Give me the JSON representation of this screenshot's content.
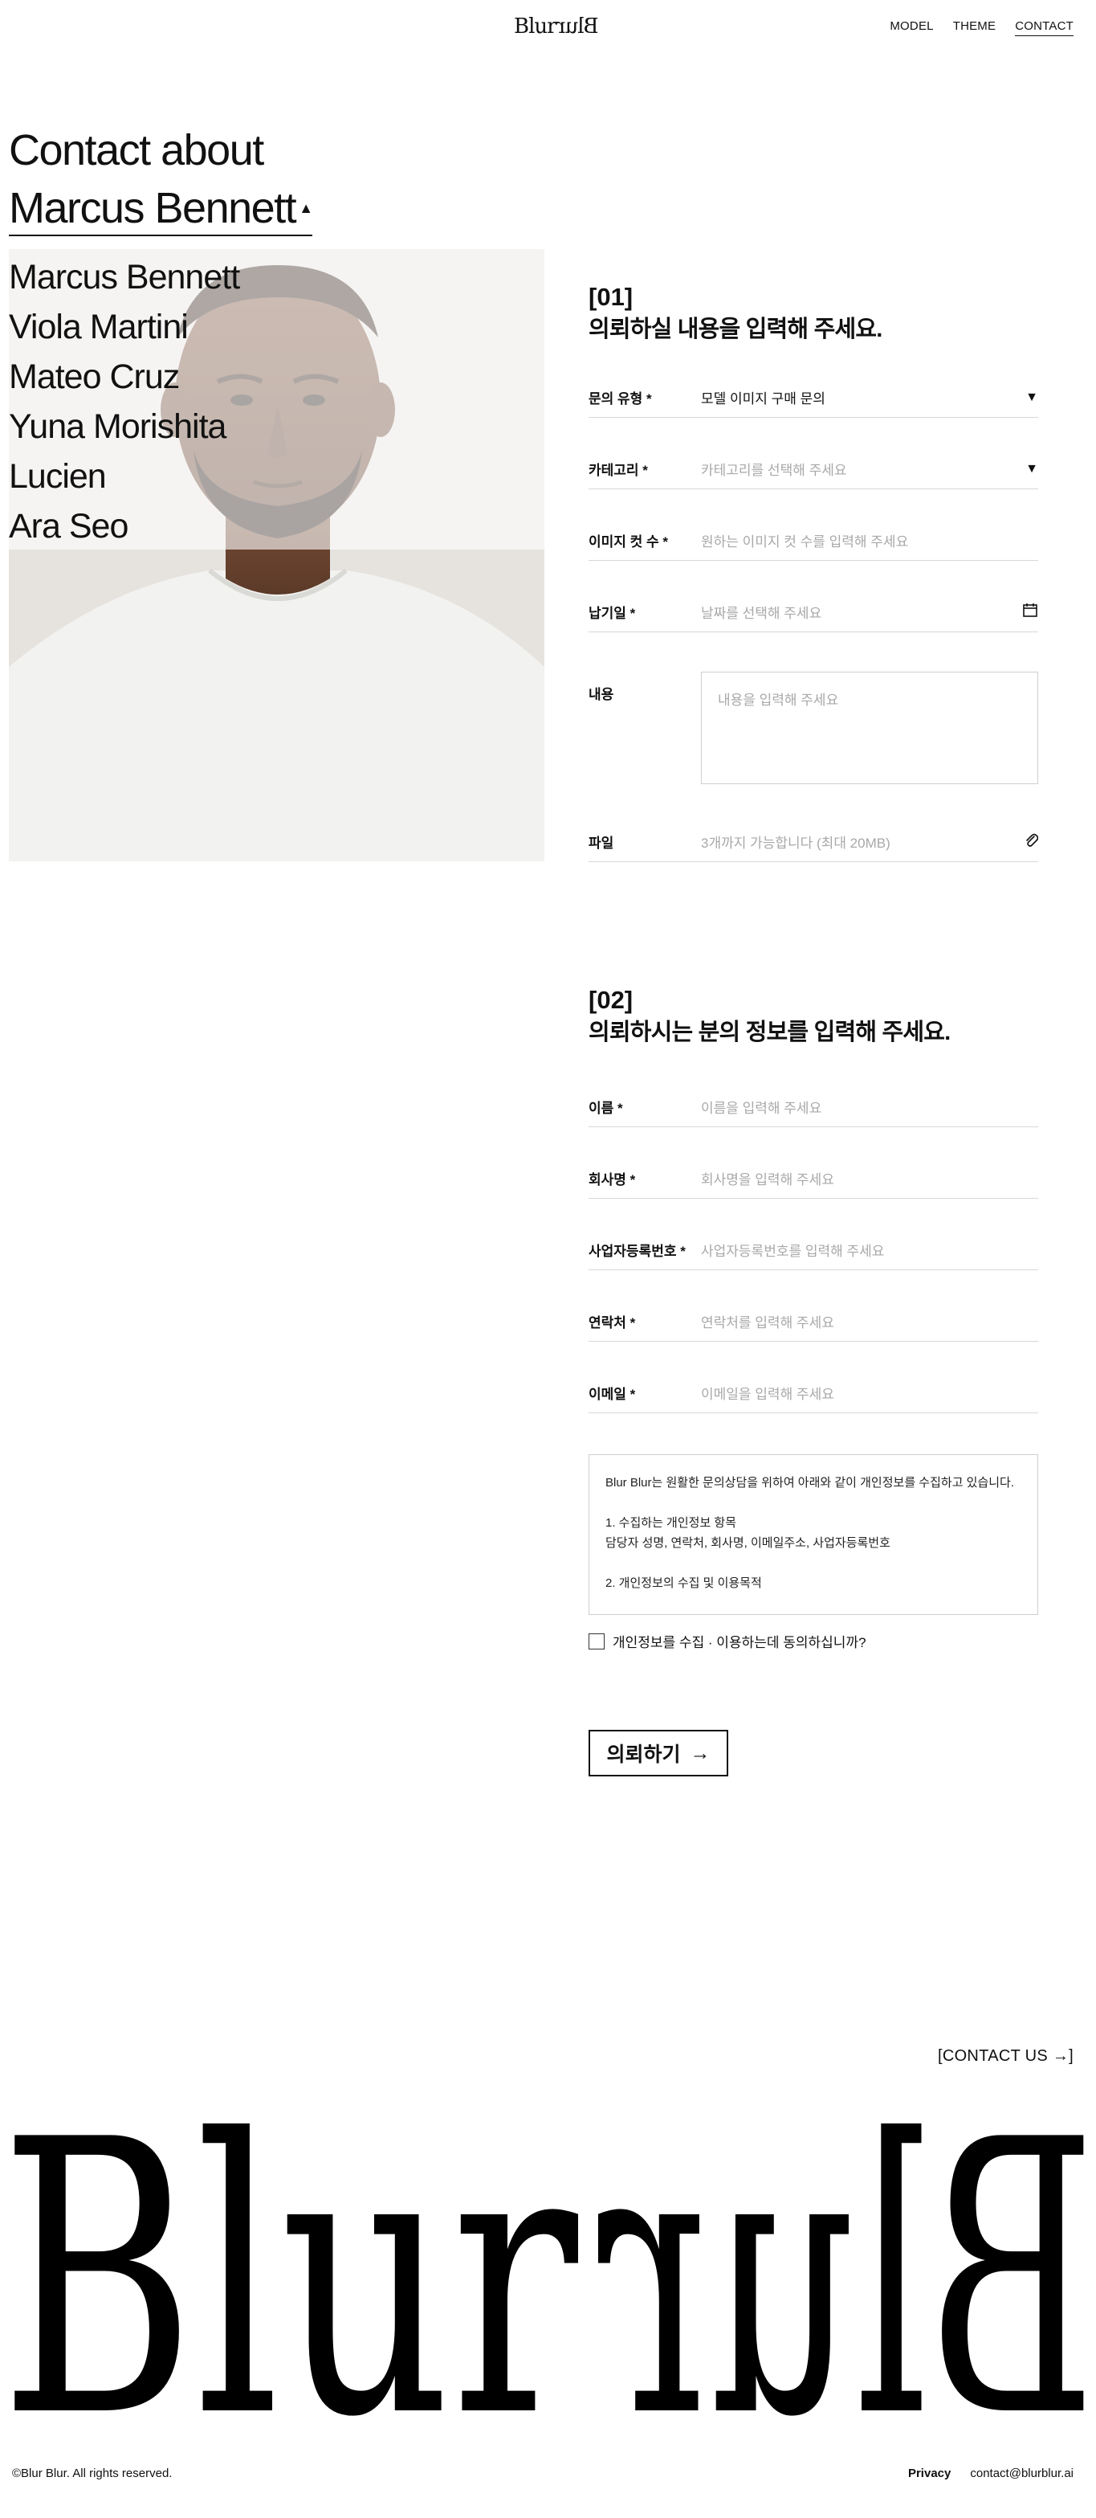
{
  "header": {
    "logo_left": "Blur",
    "logo_right": "Blur",
    "nav": [
      "MODEL",
      "THEME",
      "CONTACT"
    ]
  },
  "contact": {
    "heading": "Contact about",
    "selected_model": "Marcus Bennett",
    "caret_icon": "triangle-up",
    "models": [
      "Marcus Bennett",
      "Viola Martini",
      "Mateo Cruz",
      "Yuna Morishita",
      "Lucien",
      "Ara Seo"
    ]
  },
  "section1": {
    "number": "[01]",
    "title": "의뢰하실 내용을 입력해 주세요.",
    "fields": {
      "type": {
        "label": "문의 유형 *",
        "value": "모델 이미지 구매 문의",
        "icon": "chevron-down"
      },
      "category": {
        "label": "카테고리 *",
        "placeholder": "카테고리를 선택해 주세요",
        "icon": "chevron-down"
      },
      "cuts": {
        "label": "이미지 컷 수 *",
        "placeholder": "원하는 이미지 컷 수를 입력해 주세요"
      },
      "due": {
        "label": "납기일 *",
        "placeholder": "날짜를 선택해 주세요",
        "icon": "calendar"
      },
      "content": {
        "label": "내용",
        "placeholder": "내용을 입력해 주세요"
      },
      "file": {
        "label": "파일",
        "placeholder": "3개까지 가능합니다 (최대 20MB)",
        "icon": "paperclip"
      }
    }
  },
  "section2": {
    "number": "[02]",
    "title": "의뢰하시는 분의 정보를 입력해 주세요.",
    "fields": {
      "name": {
        "label": "이름 *",
        "placeholder": "이름을 입력해 주세요"
      },
      "company": {
        "label": "회사명 *",
        "placeholder": "회사명을 입력해 주세요"
      },
      "bizno": {
        "label": "사업자등록번호 *",
        "placeholder": "사업자등록번호를 입력해 주세요"
      },
      "phone": {
        "label": "연락처 *",
        "placeholder": "연락처를 입력해 주세요"
      },
      "email": {
        "label": "이메일 *",
        "placeholder": "이메일을 입력해 주세요"
      }
    },
    "privacy_text": {
      "intro": "Blur Blur는 원활한 문의상담을 위하여 아래와 같이 개인정보를 수집하고 있습니다.",
      "item1_title": "1. 수집하는 개인정보 항목",
      "item1_body": "담당자 성명, 연락처, 회사명, 이메일주소, 사업자등록번호",
      "item2_title": "2. 개인정보의 수집 및 이용목적"
    },
    "agree_label": "개인정보를 수집 · 이용하는데 동의하십니까?",
    "submit_label": "의뢰하기",
    "submit_icon": "arrow-right"
  },
  "footer": {
    "contact_us": "[CONTACT US →]",
    "copyright": "©Blur Blur. All rights reserved.",
    "privacy": "Privacy",
    "email": "contact@blurblur.ai"
  }
}
